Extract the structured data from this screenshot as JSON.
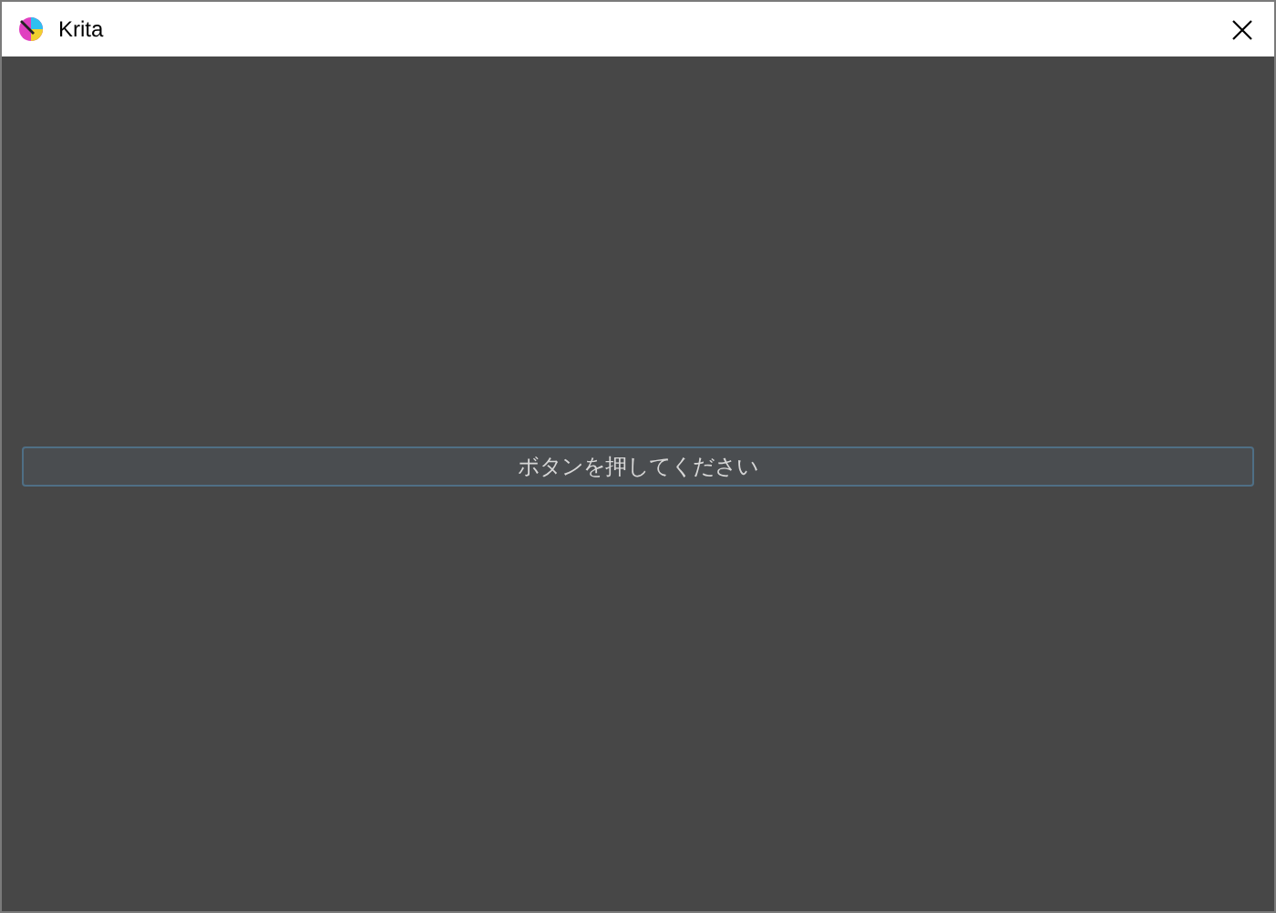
{
  "window": {
    "title": "Krita"
  },
  "button": {
    "label": "ボタンを押してください"
  }
}
